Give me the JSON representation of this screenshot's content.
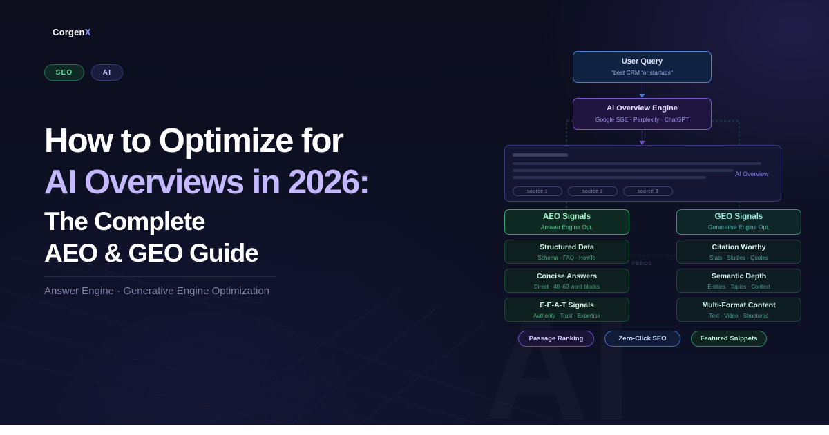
{
  "brand": {
    "name": "Corgen",
    "accent": "X"
  },
  "pills": {
    "seo": "SEO",
    "ai": "AI"
  },
  "headline": {
    "line1": "How to Optimize for",
    "line2": "AI Overviews in 2026:",
    "line3": "The Complete",
    "line4": "AEO & GEO Guide"
  },
  "subtitle": "Answer Engine · Generative Engine Optimization",
  "diagram": {
    "query": {
      "title": "User Query",
      "detail": "\"best CRM for startups\""
    },
    "engine": {
      "title": "AI Overview Engine",
      "detail": "Google SGE · Perplexity · ChatGPT"
    },
    "overview": {
      "label": "AI Overview",
      "sources": [
        "source 1",
        "source 2",
        "source 3"
      ]
    },
    "aeo": {
      "title": "AEO Signals",
      "detail": "Answer Engine Opt.",
      "items": [
        {
          "title": "Structured Data",
          "detail": "Schema · FAQ · HowTo"
        },
        {
          "title": "Concise Answers",
          "detail": "Direct · 40–60 word blocks"
        },
        {
          "title": "E-E-A-T Signals",
          "detail": "Authority · Trust · Expertise"
        }
      ]
    },
    "geo": {
      "title": "GEO Signals",
      "detail": "Generative Engine Opt.",
      "items": [
        {
          "title": "Citation Worthy",
          "detail": "Stats · Studies · Quotes"
        },
        {
          "title": "Semantic Depth",
          "detail": "Entities · Topics · Context"
        },
        {
          "title": "Multi-Format Content",
          "detail": "Text · Video · Structured"
        }
      ]
    },
    "feeds_label": "FEEDS",
    "tags": [
      "Passage Ranking",
      "Zero-Click SEO",
      "Featured Snippets"
    ]
  },
  "watermark": "AI",
  "colors": {
    "background": "#0c0e1e",
    "headline_accent": "#c4b8ff",
    "brand_accent": "#8b9cff",
    "aeo_green": "#2ea66e",
    "geo_teal": "#2f8f86",
    "engine_purple": "#7a56d6",
    "query_blue": "#4e7bd6"
  }
}
